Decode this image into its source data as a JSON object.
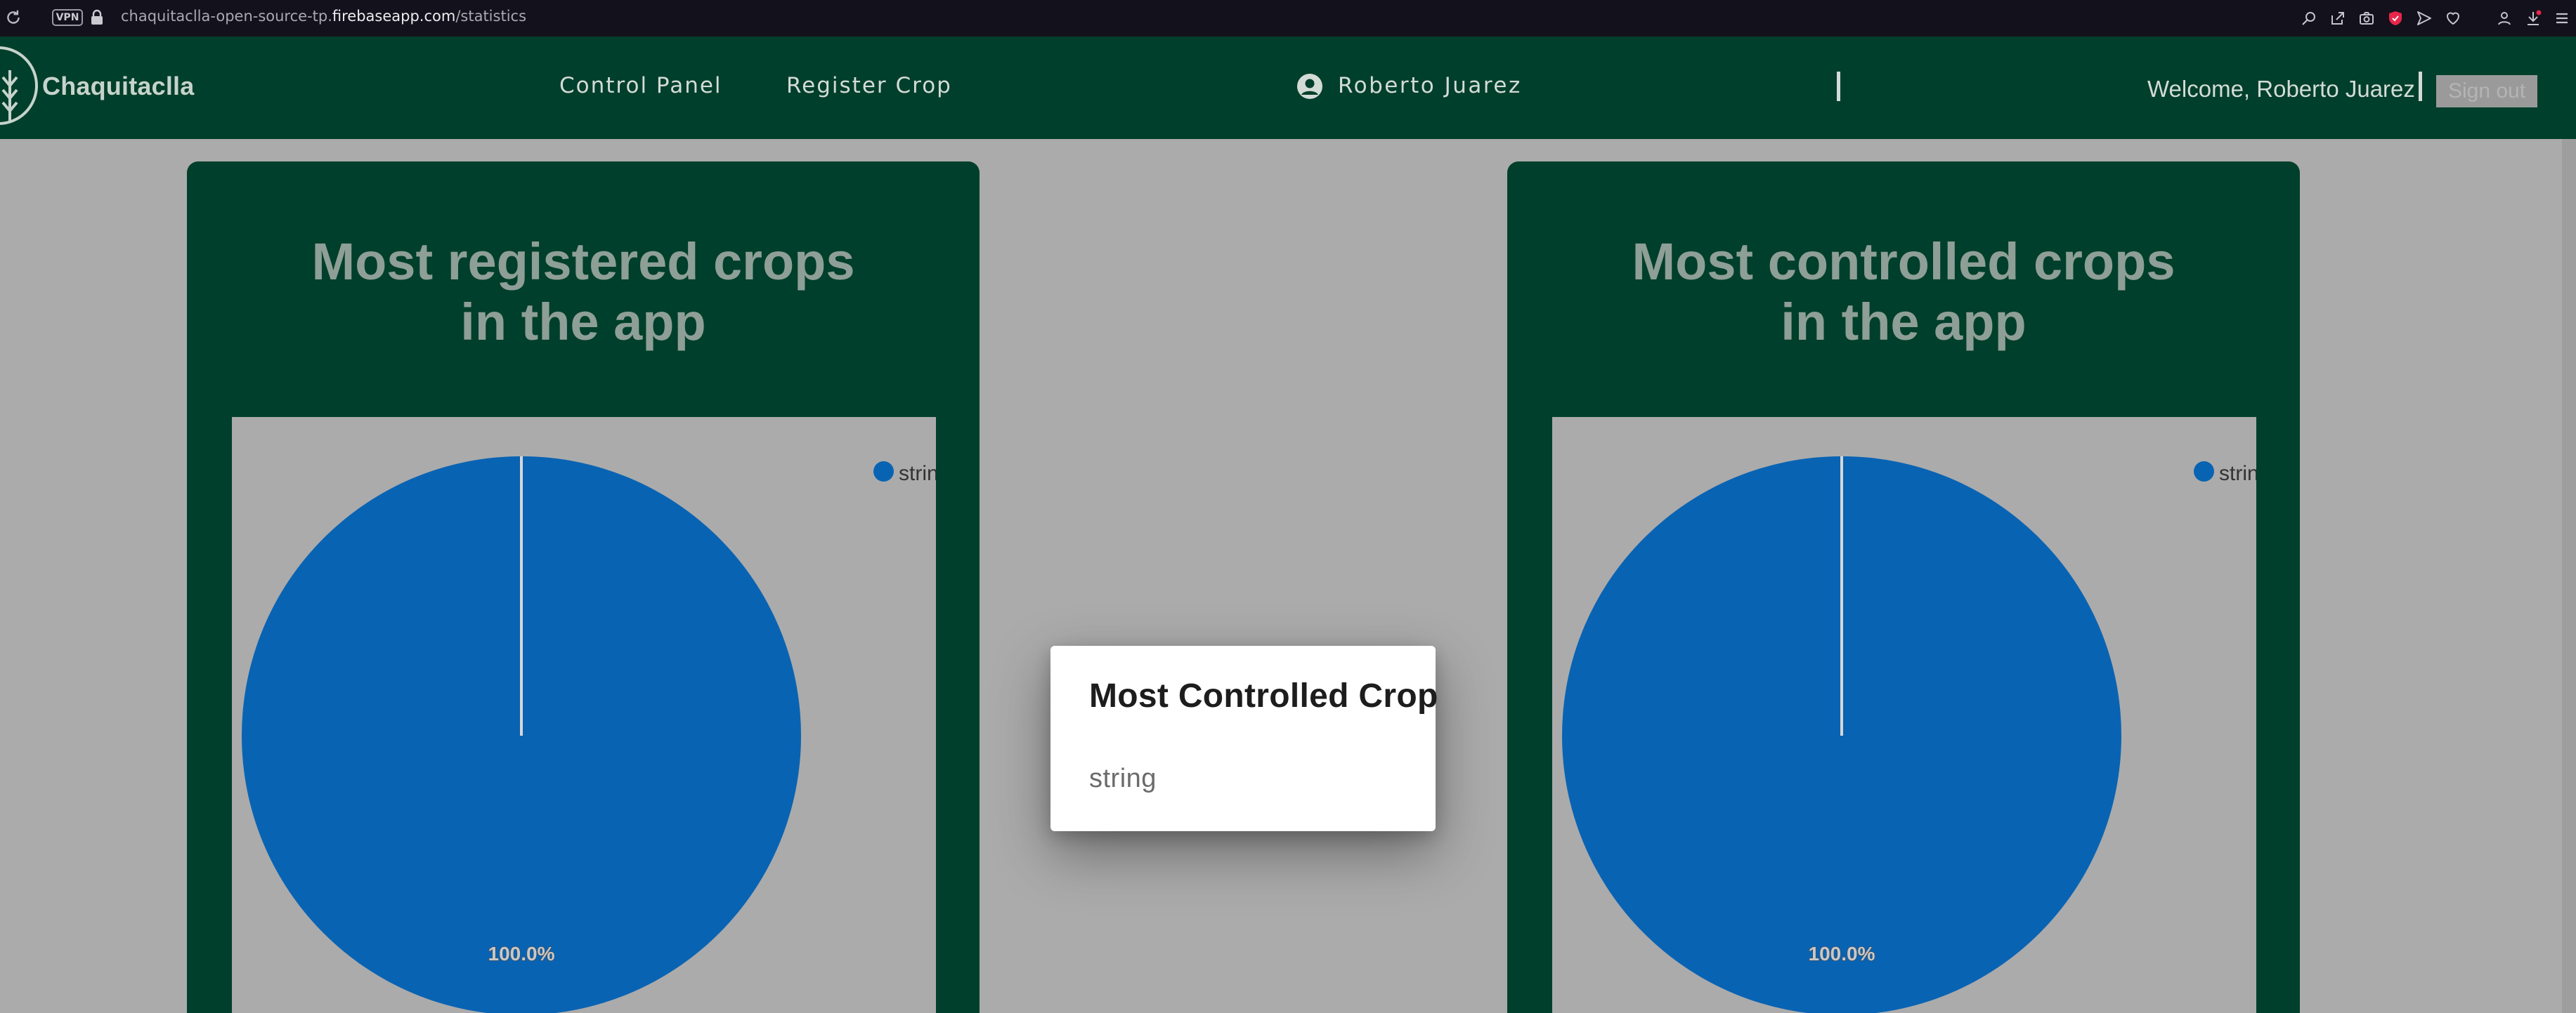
{
  "browser": {
    "vpn_badge": "VPN",
    "url_prefix": "chaquitaclla-open-source-tp.",
    "url_host": "firebaseapp.com",
    "url_path": "/statistics",
    "toolbar_icons": [
      "search-icon",
      "share-icon",
      "camera-icon",
      "shield-extension-icon",
      "send-icon",
      "heart-icon",
      "profile-icon",
      "download-icon",
      "menu-icon"
    ]
  },
  "navbar": {
    "brand": "Chaquitaclla",
    "links": [
      "Control Panel",
      "Register Crop"
    ],
    "user_name": "Roberto Juarez",
    "welcome_text": "Welcome, Roberto Juarez",
    "sign_out_label": "Sign out"
  },
  "cards": [
    {
      "title_line1": "Most registered crops",
      "title_line2": "in the app",
      "legend_label": "string",
      "slice_label": "100.0%"
    },
    {
      "title_line1": "Most controlled crops",
      "title_line2": "in the app",
      "legend_label": "string",
      "slice_label": "100.0%"
    }
  ],
  "chart_data": [
    {
      "type": "pie",
      "categories": [
        "string"
      ],
      "values": [
        100.0
      ],
      "colors": [
        "#0963b3"
      ]
    },
    {
      "type": "pie",
      "categories": [
        "string"
      ],
      "values": [
        100.0
      ],
      "colors": [
        "#0963b3"
      ]
    }
  ],
  "modal": {
    "title": "Most Controlled Crop",
    "body": "string"
  },
  "colors": {
    "navbar": "#003f2b",
    "backdrop": "#ababab",
    "pie": "#0963b3"
  }
}
